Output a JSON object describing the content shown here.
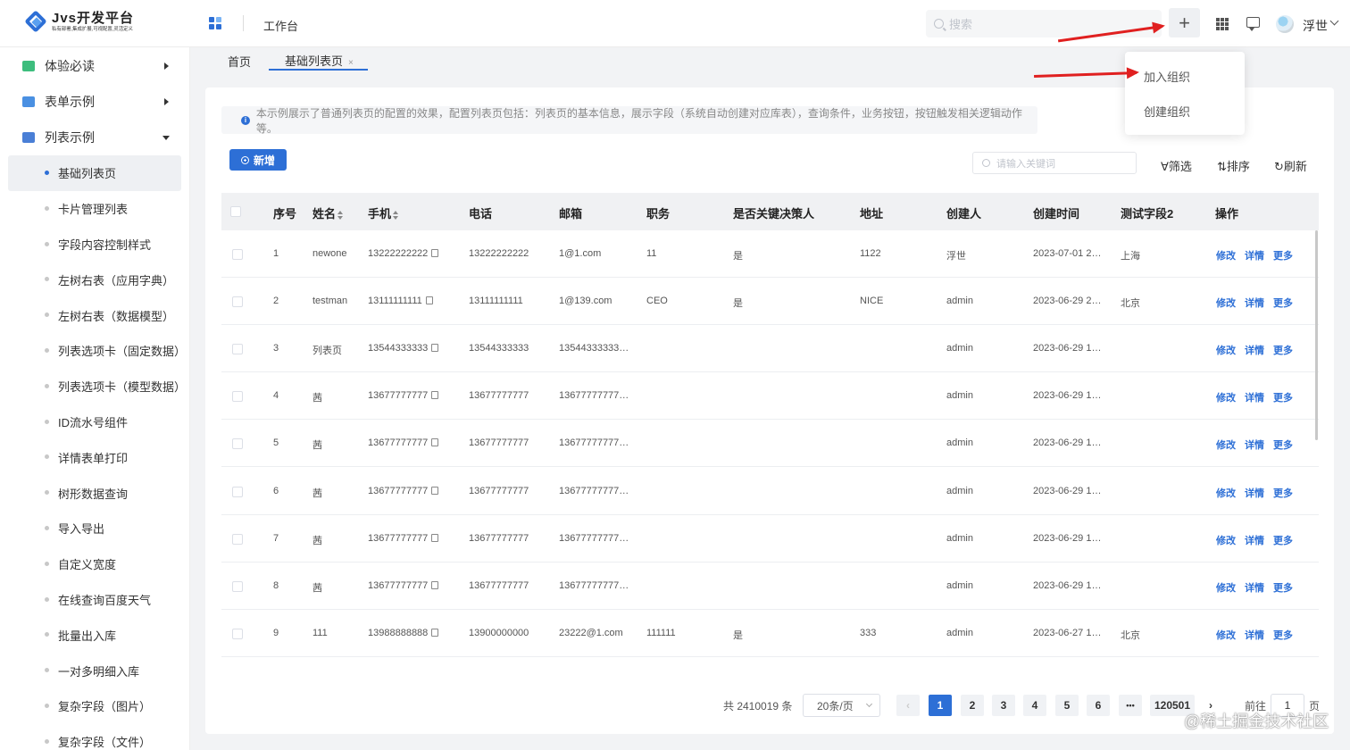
{
  "header": {
    "logo_title": "Jvs开发平台",
    "logo_subtitle": "私有部署,集成扩展,可视配置,灵活定义",
    "workbench": "工作台",
    "search_placeholder": "搜索",
    "add_symbol": "+",
    "user_name": "浮世"
  },
  "add_menu": {
    "items": [
      "加入组织",
      "创建组织"
    ]
  },
  "sidebar": {
    "groups": [
      {
        "label": "体验必读",
        "color": "#3dbd7d"
      },
      {
        "label": "表单示例",
        "color": "#4a90e2"
      },
      {
        "label": "列表示例",
        "color": "#4a7fd6"
      }
    ],
    "items": [
      "基础列表页",
      "卡片管理列表",
      "字段内容控制样式",
      "左树右表（应用字典）",
      "左树右表（数据模型）",
      "列表选项卡（固定数据）",
      "列表选项卡（模型数据）",
      "ID流水号组件",
      "详情表单打印",
      "树形数据查询",
      "导入导出",
      "自定义宽度",
      "在线查询百度天气",
      "批量出入库",
      "一对多明细入库",
      "复杂字段（图片）",
      "复杂字段（文件）"
    ]
  },
  "tabs": {
    "home": "首页",
    "current": "基础列表页",
    "close": "×"
  },
  "toolbar": {
    "info_text": "本示例展示了普通列表页的配置的效果，配置列表页包括：列表页的基本信息，展示字段（系统自动创建对应库表），查询条件，业务按钮，按钮触发相关逻辑动作等。",
    "add_label": "新增",
    "keyword_placeholder": "请输入关键词",
    "filter": "筛选",
    "sort": "排序",
    "refresh": "刷新"
  },
  "table": {
    "columns": [
      "序号",
      "姓名",
      "手机",
      "电话",
      "邮箱",
      "职务",
      "是否关键决策人",
      "地址",
      "创建人",
      "创建时间",
      "测试字段2",
      "操作"
    ],
    "actions": [
      "修改",
      "详情",
      "更多"
    ],
    "rows": [
      [
        "1",
        "newone",
        "13222222222",
        "13222222222",
        "1@1.com",
        "11",
        "是",
        "1122",
        "浮世",
        "2023-07-01 2…",
        "上海"
      ],
      [
        "2",
        "testman",
        "13111111111",
        "13111111111",
        "1@139.com",
        "CEO",
        "是",
        "NICE",
        "admin",
        "2023-06-29 2…",
        "北京"
      ],
      [
        "3",
        "列表页",
        "13544333333",
        "13544333333",
        "13544333333…",
        "",
        "",
        "",
        "admin",
        "2023-06-29 1…",
        ""
      ],
      [
        "4",
        "茜",
        "13677777777",
        "13677777777",
        "13677777777…",
        "",
        "",
        "",
        "admin",
        "2023-06-29 1…",
        ""
      ],
      [
        "5",
        "茜",
        "13677777777",
        "13677777777",
        "13677777777…",
        "",
        "",
        "",
        "admin",
        "2023-06-29 1…",
        ""
      ],
      [
        "6",
        "茜",
        "13677777777",
        "13677777777",
        "13677777777…",
        "",
        "",
        "",
        "admin",
        "2023-06-29 1…",
        ""
      ],
      [
        "7",
        "茜",
        "13677777777",
        "13677777777",
        "13677777777…",
        "",
        "",
        "",
        "admin",
        "2023-06-29 1…",
        ""
      ],
      [
        "8",
        "茜",
        "13677777777",
        "13677777777",
        "13677777777…",
        "",
        "",
        "",
        "admin",
        "2023-06-29 1…",
        ""
      ],
      [
        "9",
        "111",
        "13988888888",
        "13900000000",
        "23222@1.com",
        "111111",
        "是",
        "333",
        "admin",
        "2023-06-27 1…",
        "北京"
      ]
    ]
  },
  "pagination": {
    "total": "共 2410019 条",
    "page_size": "20条/页",
    "prev": "‹",
    "next": "›",
    "pages": [
      "1",
      "2",
      "3",
      "4",
      "5",
      "6",
      "•••",
      "120501"
    ],
    "goto_label": "前往",
    "goto_value": "1",
    "goto_suffix": "页"
  },
  "watermark": "@稀土掘金技术社区"
}
